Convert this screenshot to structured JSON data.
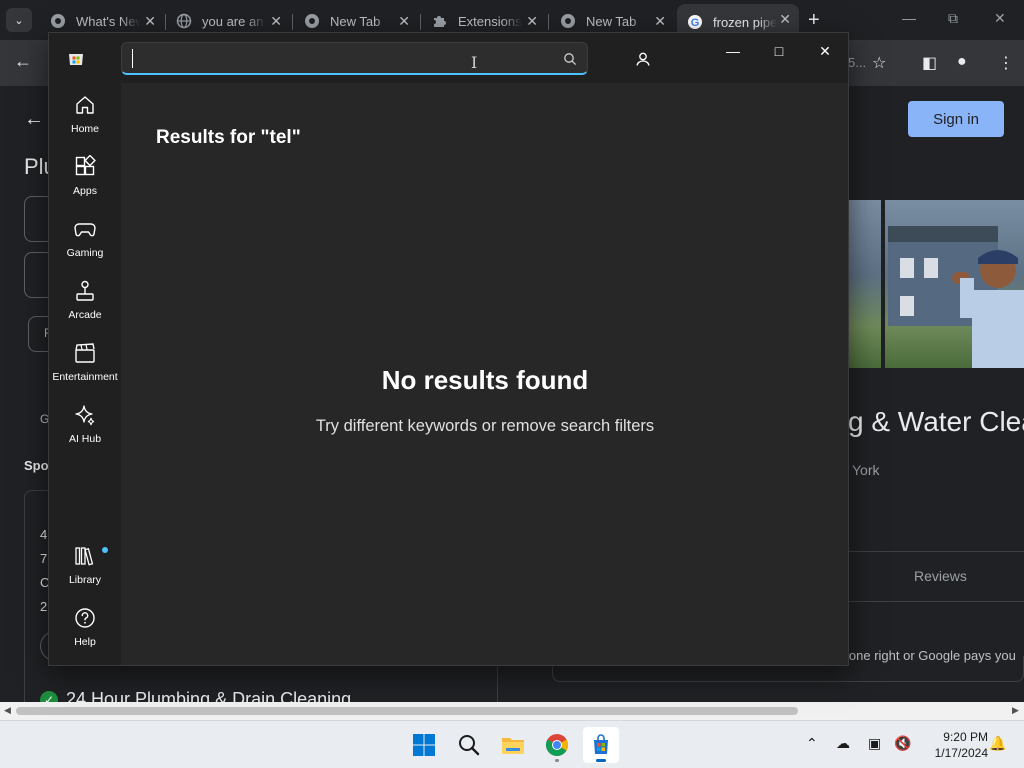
{
  "browser": {
    "tabs": [
      {
        "title": "What's New",
        "icon": "chrome-icon"
      },
      {
        "title": "you are an",
        "icon": "globe-icon"
      },
      {
        "title": "New Tab",
        "icon": "chrome-icon"
      },
      {
        "title": "Extensions",
        "icon": "puzzle-icon"
      },
      {
        "title": "New Tab",
        "icon": "chrome-icon"
      },
      {
        "title": "frozen pipe",
        "icon": "google-icon",
        "active": true
      }
    ],
    "new_tab_glyph": "+",
    "omnibox_tail": "5..."
  },
  "webpage": {
    "title_fragment": "Plu",
    "sign_in": "Sign in",
    "sponsored_fragment": "Spo",
    "card_fragments": [
      "4",
      "7",
      "C",
      "2"
    ],
    "side_fragment": "G",
    "side_fragment_2": "F",
    "bottom_listing": "24 Hour Plumbing & Drain Cleaning",
    "heading_fragment": "g & Water Clea",
    "location_fragment": "York",
    "reviews_tab": "Reviews",
    "guarantee_fragment": "lone right or Google pays you"
  },
  "store": {
    "search": {
      "value": "",
      "placeholder": ""
    },
    "results_title": "Results for \"tel\"",
    "empty_heading": "No results found",
    "empty_message": "Try different keywords or remove search filters",
    "nav": [
      {
        "label": "Home",
        "icon": "home-icon"
      },
      {
        "label": "Apps",
        "icon": "apps-icon"
      },
      {
        "label": "Gaming",
        "icon": "gamepad-icon"
      },
      {
        "label": "Arcade",
        "icon": "joystick-icon"
      },
      {
        "label": "Entertainment",
        "icon": "clapperboard-icon"
      },
      {
        "label": "AI Hub",
        "icon": "sparkle-icon"
      },
      {
        "label": "Library",
        "icon": "library-icon",
        "has_badge": true
      },
      {
        "label": "Help",
        "icon": "help-icon"
      }
    ],
    "accent": "#4cc2ff"
  },
  "taskbar": {
    "time": "9:20 PM",
    "date": "1/17/2024"
  }
}
